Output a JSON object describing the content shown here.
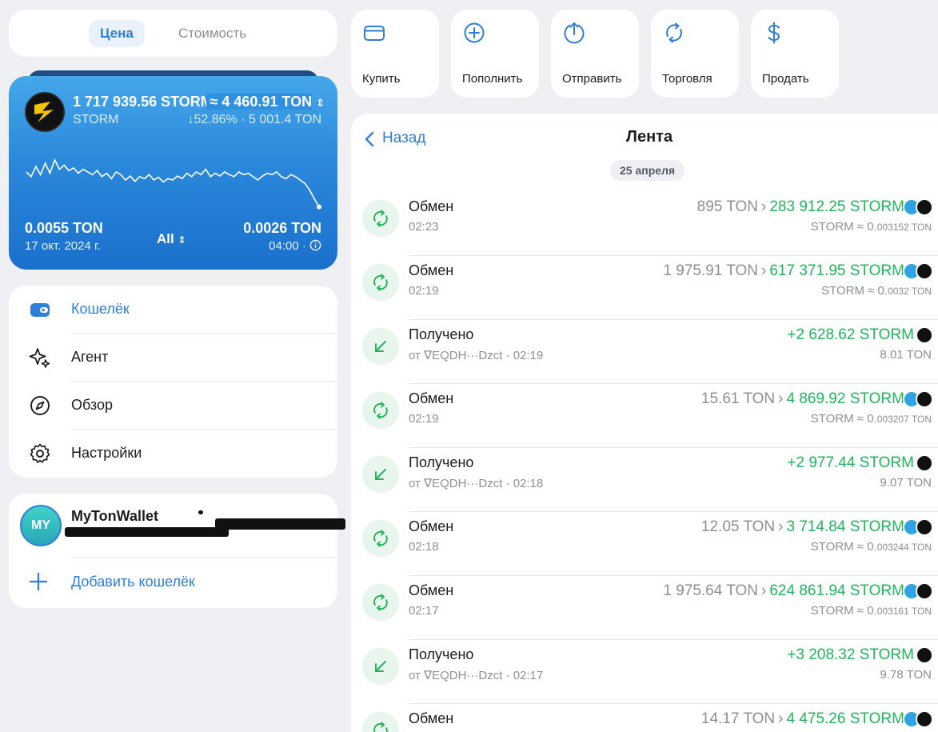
{
  "segment": {
    "active": "Цена",
    "inactive": "Стоимость"
  },
  "token_card": {
    "amount": "1 717 939.56 STORM",
    "value": "≈ 4 460.91 TON",
    "value_toggle": "⇕",
    "name": "STORM",
    "change": "↓52.86% · 5 001.4 TON",
    "low_value": "0.0055 TON",
    "low_date": "17 окт. 2024 г.",
    "period": "All",
    "period_toggle": "⇕",
    "high_value": "0.0026 TON",
    "high_time": "04:00 ·",
    "colors": {
      "start": "#45a7eb",
      "end": "#1a70cc"
    },
    "chart_data": {
      "type": "line",
      "y": [
        0.62,
        0.55,
        0.7,
        0.58,
        0.75,
        0.6,
        0.8,
        0.66,
        0.72,
        0.64,
        0.68,
        0.6,
        0.66,
        0.62,
        0.58,
        0.64,
        0.55,
        0.6,
        0.52,
        0.62,
        0.58,
        0.5,
        0.56,
        0.48,
        0.55,
        0.52,
        0.58,
        0.5,
        0.54,
        0.47,
        0.52,
        0.5,
        0.56,
        0.52,
        0.6,
        0.55,
        0.62,
        0.58,
        0.66,
        0.55,
        0.6,
        0.56,
        0.62,
        0.58,
        0.55,
        0.62,
        0.58,
        0.6,
        0.55,
        0.5,
        0.56,
        0.6,
        0.58,
        0.62,
        0.55,
        0.52,
        0.58,
        0.55,
        0.5,
        0.45,
        0.35,
        0.22,
        0.1
      ]
    }
  },
  "nav": {
    "items": [
      {
        "label": "Кошелёк",
        "icon": "wallet-icon",
        "active": true
      },
      {
        "label": "Агент",
        "icon": "sparkle-icon",
        "active": false
      },
      {
        "label": "Обзор",
        "icon": "compass-icon",
        "active": false
      },
      {
        "label": "Настройки",
        "icon": "gear-icon",
        "active": false
      }
    ]
  },
  "wallets": {
    "avatar": "MY",
    "name": "MyTonWallet",
    "add_label": "Добавить кошелёк"
  },
  "actions": [
    {
      "label": "Купить",
      "icon": "card-icon"
    },
    {
      "label": "Пополнить",
      "icon": "plus-circle-icon"
    },
    {
      "label": "Отправить",
      "icon": "send-icon"
    },
    {
      "label": "Торговля",
      "icon": "swap-icon"
    },
    {
      "label": "Продать",
      "icon": "dollar-icon"
    }
  ],
  "feed": {
    "back_label": "Назад",
    "title": "Лента",
    "date": "25 апреля",
    "transactions": [
      {
        "type": "swap",
        "title": "Обмен",
        "sub": "02:23",
        "from": "895 TON",
        "to": "283 912.25 STORM",
        "rate": "STORM ≈ 0.",
        "rate_small": "003152 TON"
      },
      {
        "type": "swap",
        "title": "Обмен",
        "sub": "02:19",
        "from": "1 975.91 TON",
        "to": "617 371.95 STORM",
        "rate": "STORM ≈ 0.",
        "rate_small": "0032 TON"
      },
      {
        "type": "receive",
        "title": "Получено",
        "sub": "от ∇EQDH···Dzct · 02:19",
        "from": "",
        "to": "+2 628.62 STORM",
        "rate": "8.01 TON",
        "rate_small": ""
      },
      {
        "type": "swap",
        "title": "Обмен",
        "sub": "02:19",
        "from": "15.61 TON",
        "to": "4 869.92 STORM",
        "rate": "STORM ≈ 0.",
        "rate_small": "003207 TON"
      },
      {
        "type": "receive",
        "title": "Получено",
        "sub": "от ∇EQDH···Dzct · 02:18",
        "from": "",
        "to": "+2 977.44 STORM",
        "rate": "9.07 TON",
        "rate_small": ""
      },
      {
        "type": "swap",
        "title": "Обмен",
        "sub": "02:18",
        "from": "12.05 TON",
        "to": "3 714.84 STORM",
        "rate": "STORM ≈ 0.",
        "rate_small": "003244 TON"
      },
      {
        "type": "swap",
        "title": "Обмен",
        "sub": "02:17",
        "from": "1 975.64 TON",
        "to": "624 861.94 STORM",
        "rate": "STORM ≈ 0.",
        "rate_small": "003161 TON"
      },
      {
        "type": "receive",
        "title": "Получено",
        "sub": "от ∇EQDH···Dzct · 02:17",
        "from": "",
        "to": "+3 208.32 STORM",
        "rate": "9.78 TON",
        "rate_small": ""
      },
      {
        "type": "swap",
        "title": "Обмен",
        "sub": "",
        "from": "14.17 TON",
        "to": "4 475.26 STORM",
        "rate": "",
        "rate_small": ""
      }
    ]
  },
  "colors": {
    "accent": "#2f7ed8",
    "positive": "#20b55a",
    "muted": "#8a8f98",
    "background": "#eef0f4"
  }
}
